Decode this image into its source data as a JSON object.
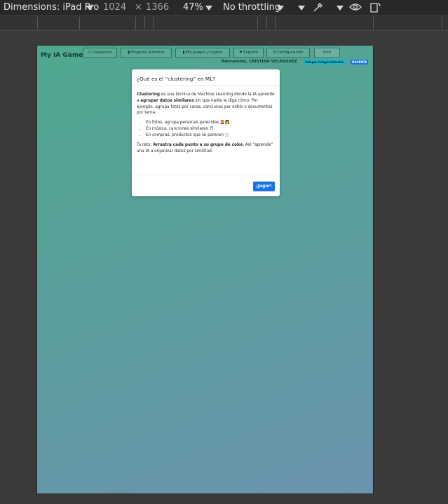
{
  "devtools": {
    "device_label": "Dimensions: iPad Pro",
    "width_value": "1024",
    "times_symbol": "×",
    "height_value": "1366",
    "zoom_label": "47%",
    "throttling_label": "No throttling",
    "icons": [
      "chevron-down-icon",
      "eyedropper-icon",
      "eye-icon",
      "rotate-device-icon"
    ]
  },
  "app": {
    "title": "My IA Game",
    "nav": [
      {
        "icon": "☷",
        "label": "Categorías"
      },
      {
        "icon": "▮",
        "label": "Progreso Alumnos"
      },
      {
        "icon": "▮",
        "label": "Mis Juegos y Logros"
      },
      {
        "icon": "⚑",
        "label": "Soporte"
      },
      {
        "icon": "⚙",
        "label": "Configuración"
      },
      {
        "icon": "",
        "label": "Salir"
      }
    ],
    "welcome_text": "Bienvenido, CRISTINA VELASQUEZ",
    "school_badge": "Colegio Colegio Helvetia",
    "role_badge": "DOCENTE",
    "accent_color": "#1b73e8"
  },
  "modal": {
    "title": "¿Qué es el “clustering” en ML?",
    "intro_bold": "Clustering",
    "intro_text_1": " es una técnica de Machine Learning donde la IA aprende a ",
    "intro_bold_2": "agrupar datos similares",
    "intro_text_2": " sin que nadie le diga cómo. Por ejemplo, agrupa fotos por caras, canciones por estilo o documentos por tema.",
    "bullets": [
      "En fotos, agrupa personas parecidas 👩‍🦰👩",
      "En música, canciones similares 🎵",
      "En compras, productos que se parecen 🛒"
    ],
    "challenge_prefix": "Tu reto: ",
    "challenge_bold": "Arrastra cada punto a su grupo de color.",
    "challenge_text": " Así “aprende” una IA a organizar datos por similitud.",
    "play_button": "¡Jugar!"
  }
}
